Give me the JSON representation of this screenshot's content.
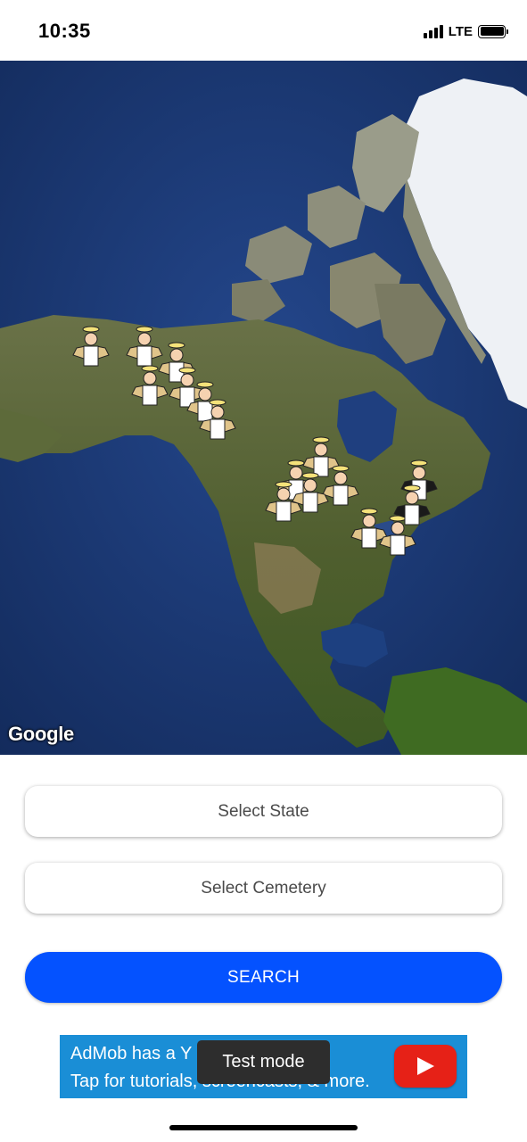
{
  "status_bar": {
    "time": "10:35",
    "network": "LTE",
    "icons": [
      "cellular-signal-icon",
      "battery-icon"
    ]
  },
  "map": {
    "provider_logo": "Google",
    "marker_icon": "angel-marker-icon",
    "colors": {
      "ocean": "#1c3a78",
      "land": "#5c6b3e",
      "ice": "#f2f4f7"
    }
  },
  "form": {
    "state_placeholder": "Select State",
    "cemetery_placeholder": "Select Cemetery",
    "search_label": "SEARCH",
    "accent_color": "#0452ff"
  },
  "ad": {
    "line1": "AdMob has a Y",
    "line2": "Tap for tutorials, screencasts, & more.",
    "icon": "youtube-play-icon",
    "badge": "Test mode"
  }
}
